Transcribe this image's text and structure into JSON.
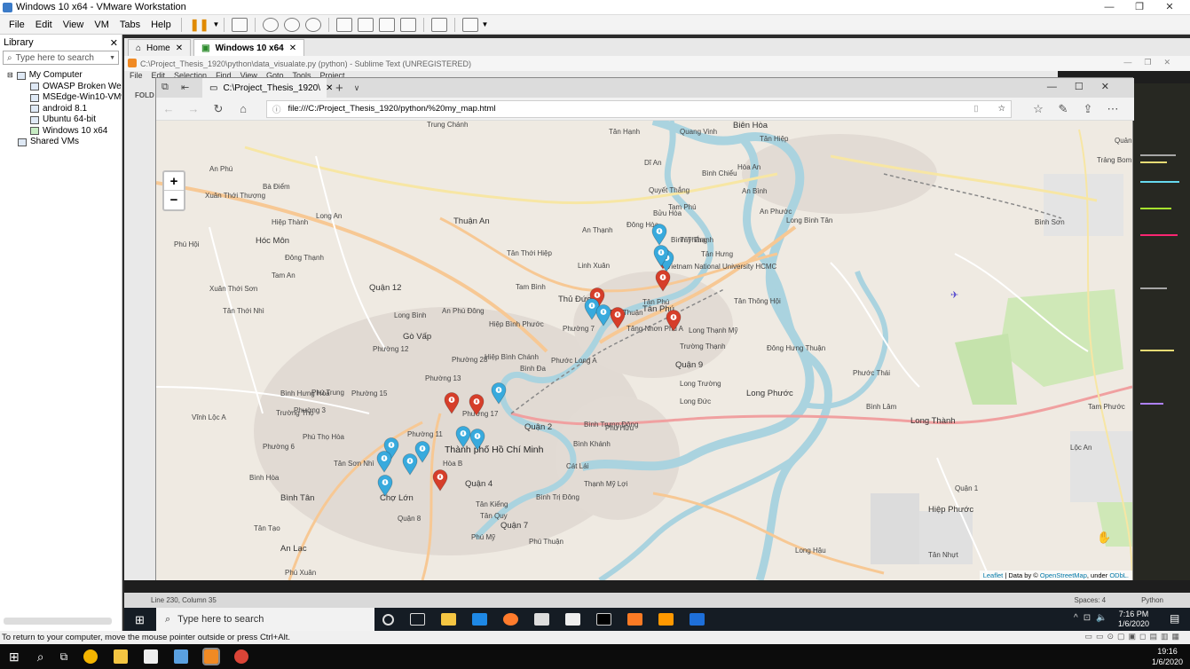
{
  "vmware": {
    "title": "Windows 10 x64 - VMware Workstation",
    "menu": [
      "File",
      "Edit",
      "View",
      "VM",
      "Tabs",
      "Help"
    ],
    "library_label": "Library",
    "search_placeholder": "Type here to search",
    "tree": [
      "My Computer",
      "OWASP Broken Web Ap",
      "MSEdge-Win10-VMware",
      "android 8.1",
      "Ubuntu 64-bit",
      "Windows 10 x64",
      "Shared VMs"
    ],
    "tabs": [
      {
        "label": "Home"
      },
      {
        "label": "Windows 10 x64"
      }
    ],
    "status_text": "To return to your computer, move the mouse pointer outside or press Ctrl+Alt."
  },
  "sublime": {
    "title": "C:\\Project_Thesis_1920\\python\\data_visualate.py (python) - Sublime Text (UNREGISTERED)",
    "menu": [
      "File",
      "Edit",
      "Selection",
      "Find",
      "View",
      "Goto",
      "Tools",
      "Project"
    ],
    "sidebar_label": "FOLD",
    "status_left": "Line 230, Column 35",
    "status_spaces": "Spaces: 4",
    "status_lang": "Python"
  },
  "edge": {
    "tab_title": "C:\\Project_Thesis_1920\\",
    "url": "file:///C:/Project_Thesis_1920/python/%20my_map.html"
  },
  "map": {
    "zoom_in": "+",
    "zoom_out": "−",
    "attribution": {
      "leaflet": "Leaflet",
      "mid": " | Data by © ",
      "osm": "OpenStreetMap",
      "under": ", under ",
      "odbl": "ODbL."
    },
    "labels": [
      "Biên Hòa",
      "Hóc Môn",
      "Thuận An",
      "Quận 12",
      "Gò Vấp",
      "Quận 9",
      "Quận 2",
      "Thành phố Hồ Chí Minh",
      "Quận 4",
      "Quận 7",
      "Bình Tân",
      "Long Thành",
      "Hiệp Phước",
      "Tân Phú",
      "Long Phước",
      "Linh Xuân",
      "An Lạc",
      "Chợ Lớn",
      "Quận 8",
      "Thủ Đức",
      "Tân Hạnh",
      "Quang Vinh",
      "Tân Hiệp",
      "Long Bình Tân",
      "Bình Thắng",
      "Đông Hòa",
      "Vietnam National University HCMC",
      "Tân Phú",
      "Long Thạnh Mỹ",
      "Trường Thạnh",
      "Long Trường",
      "Long Đức",
      "Phước Thái",
      "An Phước",
      "Bình Lâm",
      "Tam Phước",
      "Lộc An",
      "Bình Sơn",
      "Trảng Bom",
      "Quảng Tiến",
      "Tân Thới Nhì",
      "Hiệp Thành",
      "Đông Thạnh",
      "Xuân Thới Sơn",
      "Vĩnh Lộc A",
      "Tân Tạo",
      "Phú Thọ Hòa",
      "Bình Hưng Hòa",
      "Phường 12",
      "Phường 17",
      "Phường 11",
      "Hiệp Bình Chánh",
      "Hiệp Bình Phước",
      "An Phú Đông",
      "Tam Bình",
      "Tăng Nhơn Phú A",
      "Phước Long A",
      "Bình Khánh",
      "Thạnh Mỹ Lợi",
      "Cát Lái",
      "Phú Hữu",
      "Bình Trưng Đông",
      "Tân Kiểng",
      "Tân Quy",
      "Phú Mỹ",
      "Phú Thuận",
      "Phú Xuân",
      "Tân Nhựt",
      "Long Hậu",
      "Phú Hội",
      "Tam An",
      "Xuân Thới Thượng",
      "Bà Điểm",
      "Trung Chánh",
      "Tân Thới Hiệp",
      "An Thạnh",
      "Bình Chiểu",
      "Dĩ An",
      "Quyết Thắng",
      "Bửu Hòa",
      "Hòa An",
      "An Bình",
      "Bình Đa",
      "Long Bình",
      "Phường 28",
      "Phường 13",
      "Phường 15",
      "Phường 7",
      "Phường 6",
      "Phường 3",
      "Trường Thọ",
      "Bình Hòa",
      "Tân Sơn Nhì",
      "Hòa B",
      "Bình Trị Đông",
      "Phú Trung",
      "Quận 1",
      "Tân Thuận",
      "Tây Thạnh",
      "An Phú",
      "Long An",
      "Tam Phú",
      "Tân Hưng",
      "Tân Thông Hội",
      "Đông Hưng Thuận"
    ],
    "marker_colors": {
      "red": "#d63e2a",
      "blue": "#38aadd"
    }
  },
  "guest_taskbar": {
    "search_placeholder": "Type here to search",
    "time": "7:16 PM",
    "date": "1/6/2020"
  },
  "host_taskbar": {
    "time": "19:16",
    "date": "1/6/2020"
  }
}
